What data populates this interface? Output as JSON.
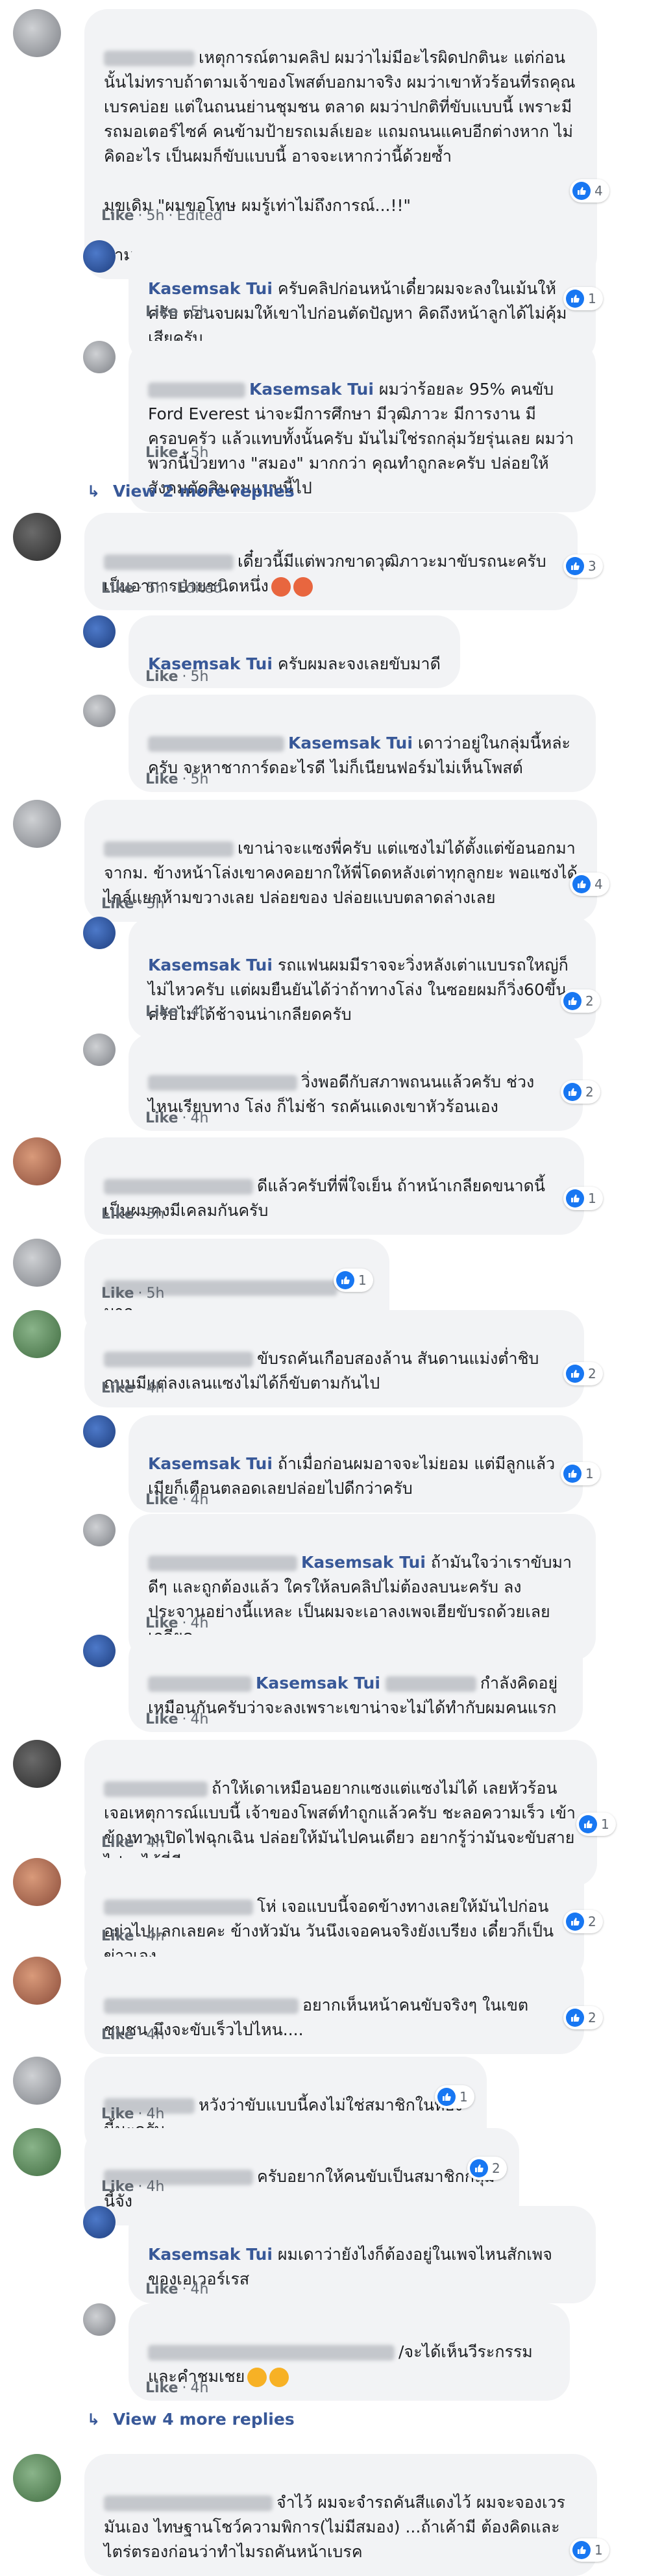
{
  "ui": {
    "like": "Like",
    "dot": "·",
    "edited": "Edited"
  },
  "comments": [
    {
      "text": "เหตุการณ์ตามคลิป ผมว่าไม่มีอะไรผิดปกตินะ แต่ก่อนนั้นไม่ทราบถ้าตามเจ้าของโพสต์บอกมาจริง ผมว่าเขาหัวร้อนที่รถคุณเบรคบ่อย แต่ในถนนย่านชุมชน ตลาด ผมว่าปกติที่ขับแบบนี้ เพราะมีรถมอเตอร์ไซค์ คนข้ามป้ายรถเมล์เยอะ แถมถนนแคบอีกต่างหาก ไม่คิดอะไร เป็นผมก็ขับแบบนี้ อาจจะเหากว่านี้ด้วยซ้ำ\n\nมุขเดิม \"ผมขอโทษ ผมรู้เท่าไม่ถึงการณ์...!!\"\n\nตามครับอยากดูตอนจบ",
      "time": "5h",
      "reactions": "4",
      "replies": [
        {
          "author": "Kasemsak Tui",
          "text": "ครับคลิปก่อนหน้าเดี๋ยวผมจะลงในเม้นให้ครับ ตอนจบผมให้เขาไปก่อนตัดปัญหา คิดถึงหน้าลูกได้ไม่คุ้มเสียครับ",
          "time": "5h",
          "reactions": "1"
        },
        {
          "mention": "Kasemsak Tui",
          "text": "ผมว่าร้อยละ 95% คนขับ Ford Everest น่าจะมีการศึกษา มีวุฒิภาวะ มีการงาน มีครอบครัว แล้วแทบทั้งนั้นครับ มันไม่ใช่รถกลุ่มวัยรุ่นเลย ผมว่าพวกนี้ป่วยทาง \"สมอง\" มากกว่า คุณทำถูกละครับ ปล่อยให้สังคมตัดสินคนแบบนี้ไป",
          "time": "5h"
        }
      ],
      "view_more": "View 2 more replies"
    },
    {
      "text": "เดี๋ยวนี้มีแต่พวกขาดวุฒิภาวะมาขับรถนะครับ เป็นอาการป่วยชนิดหนึ่ง",
      "time": "5h",
      "reactions": "3",
      "replies": [
        {
          "author": "Kasemsak Tui",
          "text": "ครับผมละจงเลยขับมาดี",
          "time": "5h"
        },
        {
          "mention": "Kasemsak Tui",
          "text": "เดาว่าอยู่ในกลุ่มนี้หล่ะครับ จะหาชาการ์ดอะไรดี ไม่ก็เนียนฟอร์มไม่เห็นโพสต์",
          "time": "5h"
        }
      ]
    },
    {
      "text": "เขาน่าจะแซงพี่ครับ แต่แซงไม่ได้ตั้งแต่ข้อนอกมาจากม. ข้างหน้าโล่งเขาคงคอยากให้พี่โดดหลังเต่าทุกลูกยะ พอแซงได้ไกล์แยกห้ามขวางเลย ปล่อยของ ปล่อยแบบตลาดล่างเลย",
      "time": "5h",
      "reactions": "4",
      "replies": [
        {
          "author": "Kasemsak Tui",
          "text": "รถแฟนผมมีราจจะวิ่งหลังเต่าแบบรถใหญ่ก็ไม่ไหวครับ แต่ผมยืนยันได้ว่าถ้าทางโล่ง ในซอยผมก็วิ่ง60ขึ้นครับไม่ได้ช้าจนน่าเกลียดครับ",
          "time": "4h",
          "reactions": "2"
        },
        {
          "text": "วิ่งพอดีกับสภาพถนนแล้วครับ ช่วงไหนเรียบทาง โล่ง ก็ไม่ช้า รถคันแดงเขาหัวร้อนเอง",
          "time": "4h",
          "reactions": "2"
        }
      ]
    },
    {
      "text": "ดีแล้วครับที่พี่ใจเย็น ถ้าหน้าเกลียดขนาดนี้เป็นผมคงมีเคลมกันครับ",
      "time": "5h",
      "reactions": "1"
    },
    {
      "text": "มาก",
      "time": "5h",
      "reactions": "1"
    },
    {
      "text": "ขับรถคันเกือบสองล้าน สันดานแม่งต่ำชิบ ถนนมีแต่ลงเลนแซงไม่ได้ก็ขับตามกันไป",
      "time": "4h",
      "reactions": "2",
      "replies": [
        {
          "author": "Kasemsak Tui",
          "text": "ถ้าเมื่อก่อนผมอาจจะไม่ยอม แต่มีลูกแล้วเมียก็เตือนตลอดเลยปล่อยไปดีกว่าครับ",
          "time": "4h",
          "reactions": "1"
        },
        {
          "mention": "Kasemsak Tui",
          "text": "ถ้ามันใจว่าเราขับมาดีๆ และถูกต้องแล้ว ใครให้ลบคลิปไม่ต้องลบนะครับ ลงประจานอย่างนี้แหละ เป็นผมจะเอาลงเพจเฮียขับรถด้วยเลย เกลียด",
          "time": "4h"
        },
        {
          "author": "Kasemsak Tui",
          "text": "กำลังคิดอยู่เหมือนกันครับว่าจะลงเพราะเขาน่าจะไม่ได้ทำกับผมคนแรก",
          "time": "4h"
        }
      ]
    },
    {
      "text": "ถ้าให้เดาเหมือนอยากแซงแต่แซงไม่ได้ เลยหัวร้อน เจอเหตุการณ์แบบนี้ เจ้าของโพสต์ทำถูกแล้วครับ ชะลอความเร็ว เข้าข้างทางเปิดไฟฉุกเฉิน ปล่อยให้มันไปคนเดียว อยากรู้ว่ามันจะขับสายไปมาได้กี่ที",
      "time": "4h",
      "reactions": "1"
    },
    {
      "text": "โห่ เจอแบบนี้จอดข้างทางเลยให้มันไปก่อน อย่าไปแลกเลยคะ ข้างหัวมัน วันนึงเจอคนจริงยังเบรียง เดี๋ยวก็เป็นข่าวเอง",
      "time": "4h",
      "reactions": "2"
    },
    {
      "text": "อยากเห็นหน้าคนขับจริงๆ ในเขตชุมชน มึงจะขับเร็วไปไหน....",
      "time": "4h",
      "reactions": "2"
    },
    {
      "text": "หวังว่าขับแบบนี้คงไม่ใช่สมาชิกในห้องนี้นะครับ",
      "time": "4h",
      "reactions": "1"
    },
    {
      "text": "ครับอยากให้คนขับเป็นสมาชิกกลุ่มนี้จัง",
      "time": "4h",
      "reactions": "2",
      "replies": [
        {
          "author": "Kasemsak Tui",
          "text": "ผมเดาว่ายังไงก็ต้องอยู่ในเพจไหนสักเพจของเอเวอร์เรส",
          "time": "4h"
        },
        {
          "text": "/จะได้เห็นวีระกรรมและคำชมเชย",
          "time": "4h"
        }
      ],
      "view_more": "View 4 more replies"
    },
    {
      "text": "จำไว้ ผมจะจำรถคันสีแดงไว้ ผมจะจองเวรมันเอง ไทษฐานโชว์ความพิการ(ไม่มีสมอง) ...ถ้าเค้ามี ต้องคิดและไตร่ตรองก่อนว่าทำไมรถคันหน้าเบรค",
      "time": "",
      "reactions": "1"
    }
  ]
}
